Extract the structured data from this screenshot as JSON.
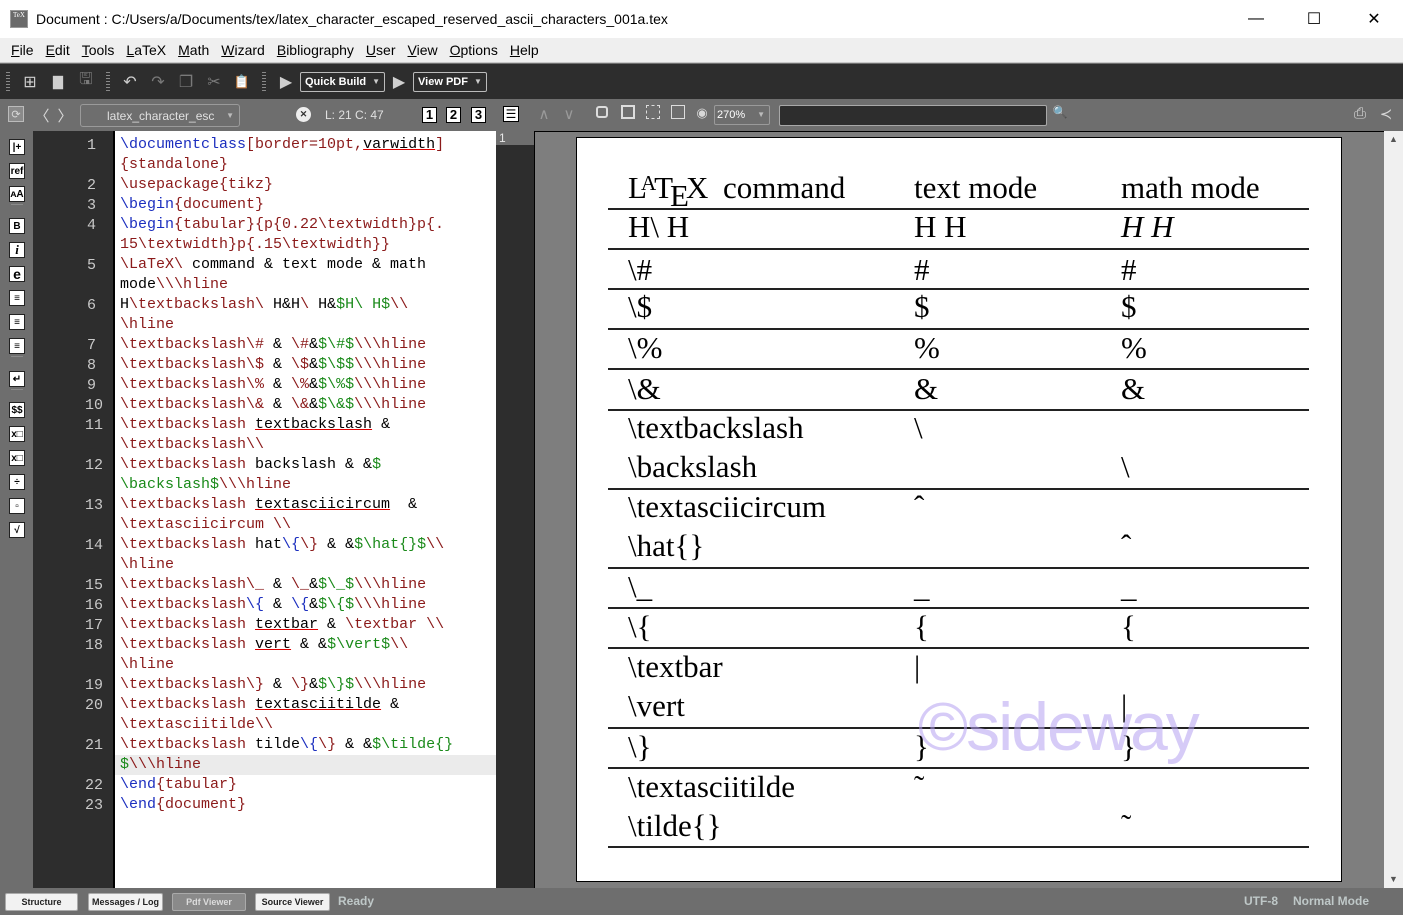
{
  "window": {
    "title": "Document : C:/Users/a/Documents/tex/latex_character_escaped_reserved_ascii_characters_001a.tex",
    "app_icon_label": "TeX",
    "controls": {
      "minimize": "—",
      "maximize": "☐",
      "close": "✕"
    }
  },
  "menu": [
    {
      "u": "F",
      "rest": "ile"
    },
    {
      "u": "E",
      "rest": "dit"
    },
    {
      "u": "T",
      "rest": "ools"
    },
    {
      "u": "L",
      "rest": "aTeX"
    },
    {
      "u": "M",
      "rest": "ath"
    },
    {
      "u": "W",
      "rest": "izard"
    },
    {
      "u": "B",
      "rest": "ibliography"
    },
    {
      "u": "U",
      "rest": "ser"
    },
    {
      "u": "V",
      "rest": "iew"
    },
    {
      "u": "O",
      "rest": "ptions"
    },
    {
      "u": "H",
      "rest": "elp"
    }
  ],
  "toolbar": {
    "new_icon": "⊞",
    "open_icon": "▇",
    "save_icon": "🖫",
    "undo_icon": "↶",
    "redo_icon": "↷",
    "copy_icon": "❐",
    "cut_icon": "✂",
    "paste_icon": "📋",
    "run_icon": "▶",
    "quick_build": "Quick Build",
    "view_pdf": "View PDF",
    "dropdown_arrow": "▼"
  },
  "navbar": {
    "sync_icon": "⟳",
    "back_icon": "〈",
    "forward_icon": "〉",
    "file_tab": "latex_character_esc",
    "close_icon": "✕",
    "position": "L: 21 C: 47",
    "bookmarks": [
      "1",
      "2",
      "3"
    ],
    "list_icon": "☰",
    "prev_icon": "∧",
    "next_icon": "∨",
    "zoom": "270%",
    "search_value": "",
    "search_icon": "🔍",
    "print_icon": "⎙",
    "external_icon": "≺"
  },
  "left_panel": [
    "|+",
    "ref",
    "ᴀA",
    "B",
    "i",
    "e",
    "≡",
    "≡",
    "≡",
    "↵",
    "$$",
    "x□",
    "x□",
    "÷",
    "▫",
    "√"
  ],
  "editor": {
    "current_line": 21,
    "lines": [
      {
        "n": "1",
        "segs": [
          [
            "k",
            "\\documentclass"
          ],
          [
            "c",
            "[border=10pt,"
          ],
          [
            "sp",
            "varwidth"
          ],
          [
            "c",
            "]"
          ]
        ]
      },
      {
        "n": "",
        "segs": [
          [
            "c",
            "{standalone}"
          ]
        ]
      },
      {
        "n": "2",
        "segs": [
          [
            "c",
            "\\usepackage{tikz}"
          ]
        ]
      },
      {
        "n": "3",
        "segs": [
          [
            "k",
            "\\begin"
          ],
          [
            "c",
            "{document}"
          ]
        ]
      },
      {
        "n": "4",
        "segs": [
          [
            "k",
            "\\begin"
          ],
          [
            "c",
            "{tabular}{p{0.22\\textwidth}p{."
          ]
        ]
      },
      {
        "n": "",
        "segs": [
          [
            "c",
            "15\\textwidth}p{.15\\textwidth}}"
          ]
        ]
      },
      {
        "n": "5",
        "segs": [
          [
            "c",
            "\\LaTeX\\ "
          ],
          [
            "b",
            "command & text mode & math"
          ]
        ]
      },
      {
        "n": "",
        "segs": [
          [
            "b",
            "mode"
          ],
          [
            "c",
            "\\\\\\hline"
          ]
        ]
      },
      {
        "n": "6",
        "segs": [
          [
            "b",
            "H"
          ],
          [
            "c",
            "\\textbackslash\\ "
          ],
          [
            "b",
            "H&H"
          ],
          [
            "c",
            "\\ "
          ],
          [
            "b",
            "H&"
          ],
          [
            "m",
            "$H\\ H$"
          ],
          [
            "c",
            "\\\\"
          ]
        ]
      },
      {
        "n": "",
        "segs": [
          [
            "c",
            "\\hline"
          ]
        ]
      },
      {
        "n": "7",
        "segs": [
          [
            "c",
            "\\textbackslash\\# "
          ],
          [
            "b",
            "& "
          ],
          [
            "c",
            "\\#"
          ],
          [
            "b",
            "&"
          ],
          [
            "m",
            "$\\#$"
          ],
          [
            "c",
            "\\\\\\hline"
          ]
        ]
      },
      {
        "n": "8",
        "segs": [
          [
            "c",
            "\\textbackslash\\$ "
          ],
          [
            "b",
            "& "
          ],
          [
            "c",
            "\\$"
          ],
          [
            "b",
            "&"
          ],
          [
            "m",
            "$\\$$"
          ],
          [
            "c",
            "\\\\\\hline"
          ]
        ]
      },
      {
        "n": "9",
        "segs": [
          [
            "c",
            "\\textbackslash\\% "
          ],
          [
            "b",
            "& "
          ],
          [
            "c",
            "\\%"
          ],
          [
            "b",
            "&"
          ],
          [
            "m",
            "$\\%$"
          ],
          [
            "c",
            "\\\\\\hline"
          ]
        ]
      },
      {
        "n": "10",
        "segs": [
          [
            "c",
            "\\textbackslash\\& "
          ],
          [
            "b",
            "& "
          ],
          [
            "c",
            "\\&"
          ],
          [
            "b",
            "&"
          ],
          [
            "m",
            "$\\&$"
          ],
          [
            "c",
            "\\\\\\hline"
          ]
        ]
      },
      {
        "n": "11",
        "segs": [
          [
            "c",
            "\\textbackslash "
          ],
          [
            "sp",
            "textbackslash"
          ],
          [
            "b",
            " &"
          ]
        ]
      },
      {
        "n": "",
        "segs": [
          [
            "c",
            "\\textbackslash\\\\"
          ]
        ]
      },
      {
        "n": "12",
        "segs": [
          [
            "c",
            "\\textbackslash "
          ],
          [
            "b",
            "backslash & &"
          ],
          [
            "m",
            "$"
          ]
        ]
      },
      {
        "n": "",
        "segs": [
          [
            "m",
            "\\backslash$"
          ],
          [
            "c",
            "\\\\\\hline"
          ]
        ]
      },
      {
        "n": "13",
        "segs": [
          [
            "c",
            "\\textbackslash "
          ],
          [
            "sp",
            "textasciicircum"
          ],
          [
            "b",
            "  &"
          ]
        ]
      },
      {
        "n": "",
        "segs": [
          [
            "c",
            "\\textasciicircum \\\\"
          ]
        ]
      },
      {
        "n": "14",
        "segs": [
          [
            "c",
            "\\textbackslash "
          ],
          [
            "b",
            "hat"
          ],
          [
            "k",
            "\\{"
          ],
          [
            "c",
            "\\}"
          ],
          [
            "b",
            " & &"
          ],
          [
            "m",
            "$\\hat{}$"
          ],
          [
            "c",
            "\\\\"
          ]
        ]
      },
      {
        "n": "",
        "segs": [
          [
            "c",
            "\\hline"
          ]
        ]
      },
      {
        "n": "15",
        "segs": [
          [
            "c",
            "\\textbackslash\\_ "
          ],
          [
            "b",
            "& "
          ],
          [
            "c",
            "\\_"
          ],
          [
            "b",
            "&"
          ],
          [
            "m",
            "$\\_$"
          ],
          [
            "c",
            "\\\\\\hline"
          ]
        ]
      },
      {
        "n": "16",
        "segs": [
          [
            "c",
            "\\textbackslash"
          ],
          [
            "k",
            "\\{"
          ],
          [
            "b",
            " & "
          ],
          [
            "k",
            "\\{"
          ],
          [
            "b",
            "&"
          ],
          [
            "m",
            "$\\{$"
          ],
          [
            "c",
            "\\\\\\hline"
          ]
        ]
      },
      {
        "n": "17",
        "segs": [
          [
            "c",
            "\\textbackslash "
          ],
          [
            "sp",
            "textbar"
          ],
          [
            "b",
            " & "
          ],
          [
            "c",
            "\\textbar \\\\"
          ]
        ]
      },
      {
        "n": "18",
        "segs": [
          [
            "c",
            "\\textbackslash "
          ],
          [
            "sp",
            "vert"
          ],
          [
            "b",
            " & &"
          ],
          [
            "m",
            "$\\vert$"
          ],
          [
            "c",
            "\\\\"
          ]
        ]
      },
      {
        "n": "",
        "segs": [
          [
            "c",
            "\\hline"
          ]
        ]
      },
      {
        "n": "19",
        "segs": [
          [
            "c",
            "\\textbackslash\\} "
          ],
          [
            "b",
            "& "
          ],
          [
            "c",
            "\\}"
          ],
          [
            "b",
            "&"
          ],
          [
            "m",
            "$\\}$"
          ],
          [
            "c",
            "\\\\\\hline"
          ]
        ]
      },
      {
        "n": "20",
        "segs": [
          [
            "c",
            "\\textbackslash "
          ],
          [
            "sp",
            "textasciitilde"
          ],
          [
            "b",
            " &"
          ]
        ]
      },
      {
        "n": "",
        "segs": [
          [
            "c",
            "\\textasciitilde\\\\"
          ]
        ]
      },
      {
        "n": "21",
        "segs": [
          [
            "c",
            "\\textbackslash "
          ],
          [
            "b",
            "tilde"
          ],
          [
            "k",
            "\\{"
          ],
          [
            "c",
            "\\}"
          ],
          [
            "b",
            " & &"
          ],
          [
            "m",
            "$\\tilde{}"
          ]
        ]
      },
      {
        "n": "",
        "segs": [
          [
            "m",
            "$"
          ],
          [
            "c",
            "\\\\\\hline"
          ]
        ]
      },
      {
        "n": "22",
        "segs": [
          [
            "k",
            "\\end"
          ],
          [
            "c",
            "{tabular}"
          ]
        ]
      },
      {
        "n": "23",
        "segs": [
          [
            "k",
            "\\end"
          ],
          [
            "c",
            "{document}"
          ]
        ]
      }
    ]
  },
  "pdf": {
    "page_number": "1",
    "header": {
      "col1_suffix": "command",
      "col2": "text mode",
      "col3": "math mode"
    },
    "rows": [
      [
        "H\\ H",
        "H H",
        "H  H"
      ],
      [
        "\\#",
        "#",
        "#"
      ],
      [
        "\\$",
        "$",
        "$"
      ],
      [
        "\\%",
        "%",
        "%"
      ],
      [
        "\\&",
        "&",
        "&"
      ],
      [
        "\\textbackslash",
        "\\",
        ""
      ],
      [
        "\\backslash",
        "",
        "\\"
      ],
      [
        "\\textasciicircum",
        "ˆ",
        ""
      ],
      [
        "\\hat{}",
        "",
        "ˆ"
      ],
      [
        "\\_",
        "_",
        "_"
      ],
      [
        "\\{",
        "{",
        "{"
      ],
      [
        "\\textbar",
        "|",
        ""
      ],
      [
        "\\vert",
        "",
        "|"
      ],
      [
        "\\}",
        "}",
        "}"
      ],
      [
        "\\textasciitilde",
        "˜",
        ""
      ],
      [
        "\\tilde{}",
        "",
        "˜"
      ]
    ],
    "watermark": "©sideway"
  },
  "scroll": {
    "up": "▲",
    "down": "▼"
  },
  "statusbar": {
    "buttons": [
      "Structure",
      "Messages / Log",
      "Pdf Viewer",
      "Source Viewer"
    ],
    "active": "Pdf Viewer",
    "status": "Ready",
    "encoding": "UTF-8",
    "mode": "Normal Mode"
  }
}
